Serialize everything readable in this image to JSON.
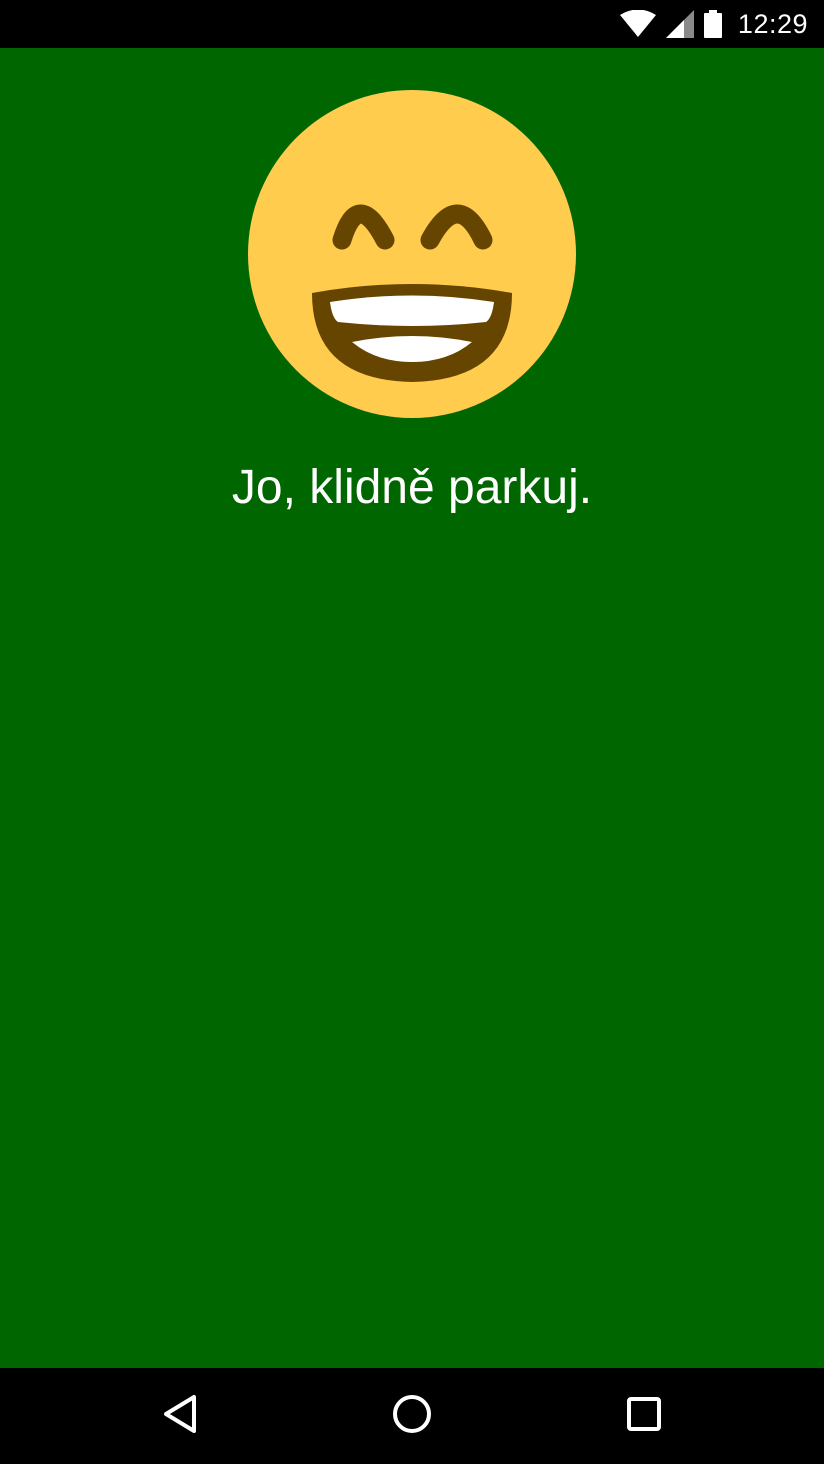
{
  "status_bar": {
    "time": "12:29",
    "icons": [
      "wifi-icon",
      "cell-signal-icon",
      "battery-icon"
    ]
  },
  "main": {
    "background_color": "#006600",
    "emoji": "grinning-face-with-smiling-eyes-icon",
    "message": "Jo, klidně parkuj."
  },
  "nav_bar": {
    "buttons": [
      "back-icon",
      "home-icon",
      "recents-icon"
    ]
  },
  "colors": {
    "emoji_face": "#FFCC4D",
    "emoji_features": "#664500",
    "text": "#FFFFFF"
  }
}
